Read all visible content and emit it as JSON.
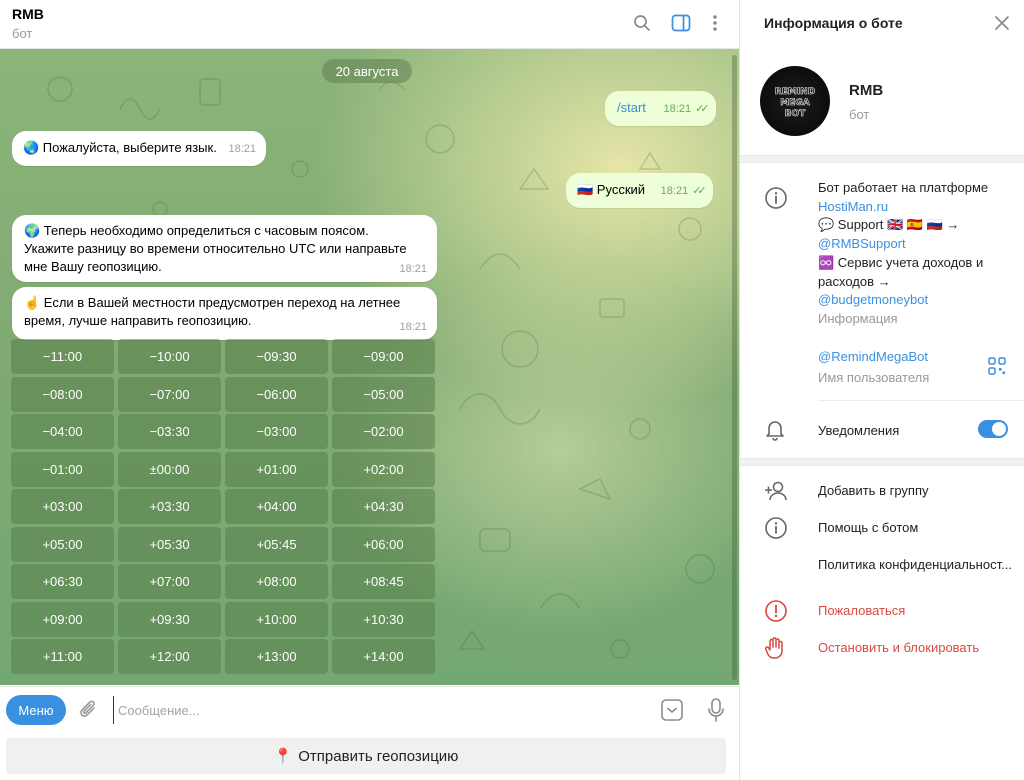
{
  "chat": {
    "title": "RMB",
    "subtitle": "бот",
    "date": "20 августа",
    "messages": [
      {
        "text": "/start",
        "time": "18:21",
        "out": true
      },
      {
        "text": "🌏 Пожалуйста, выберите язык.",
        "time": "18:21",
        "out": false
      },
      {
        "text": "🇷🇺 Русский",
        "time": "18:21",
        "out": true
      },
      {
        "lines": [
          "🌍 Теперь необходимо определиться с часовым поясом.",
          "Укажите разницу во времени относительно UTC или направьте",
          "мне Вашу геопозицию."
        ],
        "time": "18:21",
        "out": false
      },
      {
        "lines": [
          "☝️ Если в Вашей местности предусмотрен переход на летнее",
          "время, лучше направить геопозицию."
        ],
        "time": "18:21",
        "out": false
      }
    ],
    "keyboard": [
      "−11:00",
      "−10:00",
      "−09:30",
      "−09:00",
      "−08:00",
      "−07:00",
      "−06:00",
      "−05:00",
      "−04:00",
      "−03:30",
      "−03:00",
      "−02:00",
      "−01:00",
      "±00:00",
      "+01:00",
      "+02:00",
      "+03:00",
      "+03:30",
      "+04:00",
      "+04:30",
      "+05:00",
      "+05:30",
      "+05:45",
      "+06:00",
      "+06:30",
      "+07:00",
      "+08:00",
      "+08:45",
      "+09:00",
      "+09:30",
      "+10:00",
      "+10:30",
      "+11:00",
      "+12:00",
      "+13:00",
      "+14:00"
    ],
    "composer": {
      "menu_label": "Меню",
      "placeholder": "Сообщение..."
    },
    "geo_button": "Отправить геопозицию"
  },
  "panel": {
    "title": "Информация о боте",
    "bot_name": "RMB",
    "bot_sub": "бот",
    "avatar_lines": [
      "REMIND",
      "MEGA",
      "BOT"
    ],
    "info": {
      "line1": "Бот работает на платформе",
      "link1": "HostiMan.ru",
      "line2": "💬 Support 🇬🇧 🇪🇸 🇷🇺 →",
      "link2": "@RMBSupport",
      "line3": "♾️ Сервис учета доходов и",
      "line4": "расходов →",
      "link3": "@budgetmoneybot",
      "caption": "Информация"
    },
    "username": "@RemindMegaBot",
    "username_caption": "Имя пользователя",
    "notifications": "Уведомления",
    "notifications_on": true,
    "actions": {
      "add_group": "Добавить в группу",
      "help": "Помощь с ботом",
      "privacy": "Политика конфиденциальност...",
      "report": "Пожаловаться",
      "stop": "Остановить и блокировать"
    }
  },
  "colors": {
    "accent": "#3a90e0",
    "danger": "#d9493e",
    "outgoing_bubble": "#eefed8"
  }
}
